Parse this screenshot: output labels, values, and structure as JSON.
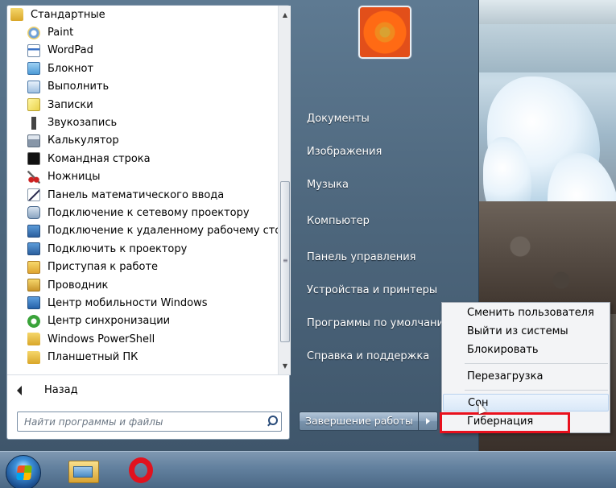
{
  "programs": {
    "items": [
      {
        "label": "Стандартные",
        "icon": "folder-icon"
      },
      {
        "label": "Paint",
        "icon": "paint-icon"
      },
      {
        "label": "WordPad",
        "icon": "wordpad-icon"
      },
      {
        "label": "Блокнот",
        "icon": "notepad-icon"
      },
      {
        "label": "Выполнить",
        "icon": "run-icon"
      },
      {
        "label": "Записки",
        "icon": "sticky-notes-icon"
      },
      {
        "label": "Звукозапись",
        "icon": "microphone-icon"
      },
      {
        "label": "Калькулятор",
        "icon": "calculator-icon"
      },
      {
        "label": "Командная строка",
        "icon": "cmd-icon"
      },
      {
        "label": "Ножницы",
        "icon": "scissors-icon"
      },
      {
        "label": "Панель математического ввода",
        "icon": "math-input-icon"
      },
      {
        "label": "Подключение к сетевому проектору",
        "icon": "network-projector-icon"
      },
      {
        "label": "Подключение к удаленному рабочему стол",
        "icon": "remote-desktop-icon"
      },
      {
        "label": "Подключить к проектору",
        "icon": "projector-icon"
      },
      {
        "label": "Приступая к работе",
        "icon": "getting-started-icon"
      },
      {
        "label": "Проводник",
        "icon": "explorer-icon"
      },
      {
        "label": "Центр мобильности Windows",
        "icon": "mobility-center-icon"
      },
      {
        "label": "Центр синхронизации",
        "icon": "sync-center-icon"
      },
      {
        "label": "Windows PowerShell",
        "icon": "folder-icon"
      },
      {
        "label": "Планшетный ПК",
        "icon": "folder-icon"
      }
    ],
    "back_label": "Назад"
  },
  "search": {
    "placeholder": "Найти программы и файлы"
  },
  "right_pane": {
    "links": [
      "Документы",
      "Изображения",
      "Музыка",
      "Компьютер",
      "Панель управления",
      "Устройства и принтеры",
      "Программы по умолчанию",
      "Справка и поддержка"
    ],
    "shutdown_label": "Завершение работы"
  },
  "power_menu": {
    "items": [
      "Сменить пользователя",
      "Выйти из системы",
      "Блокировать",
      "Перезагрузка",
      "Сон",
      "Гибернация"
    ],
    "highlighted": "Гибернация",
    "highlight_color": "#e8101d"
  },
  "taskbar": {
    "pinned": [
      "start-orb",
      "explorer-icon",
      "opera-icon"
    ]
  }
}
